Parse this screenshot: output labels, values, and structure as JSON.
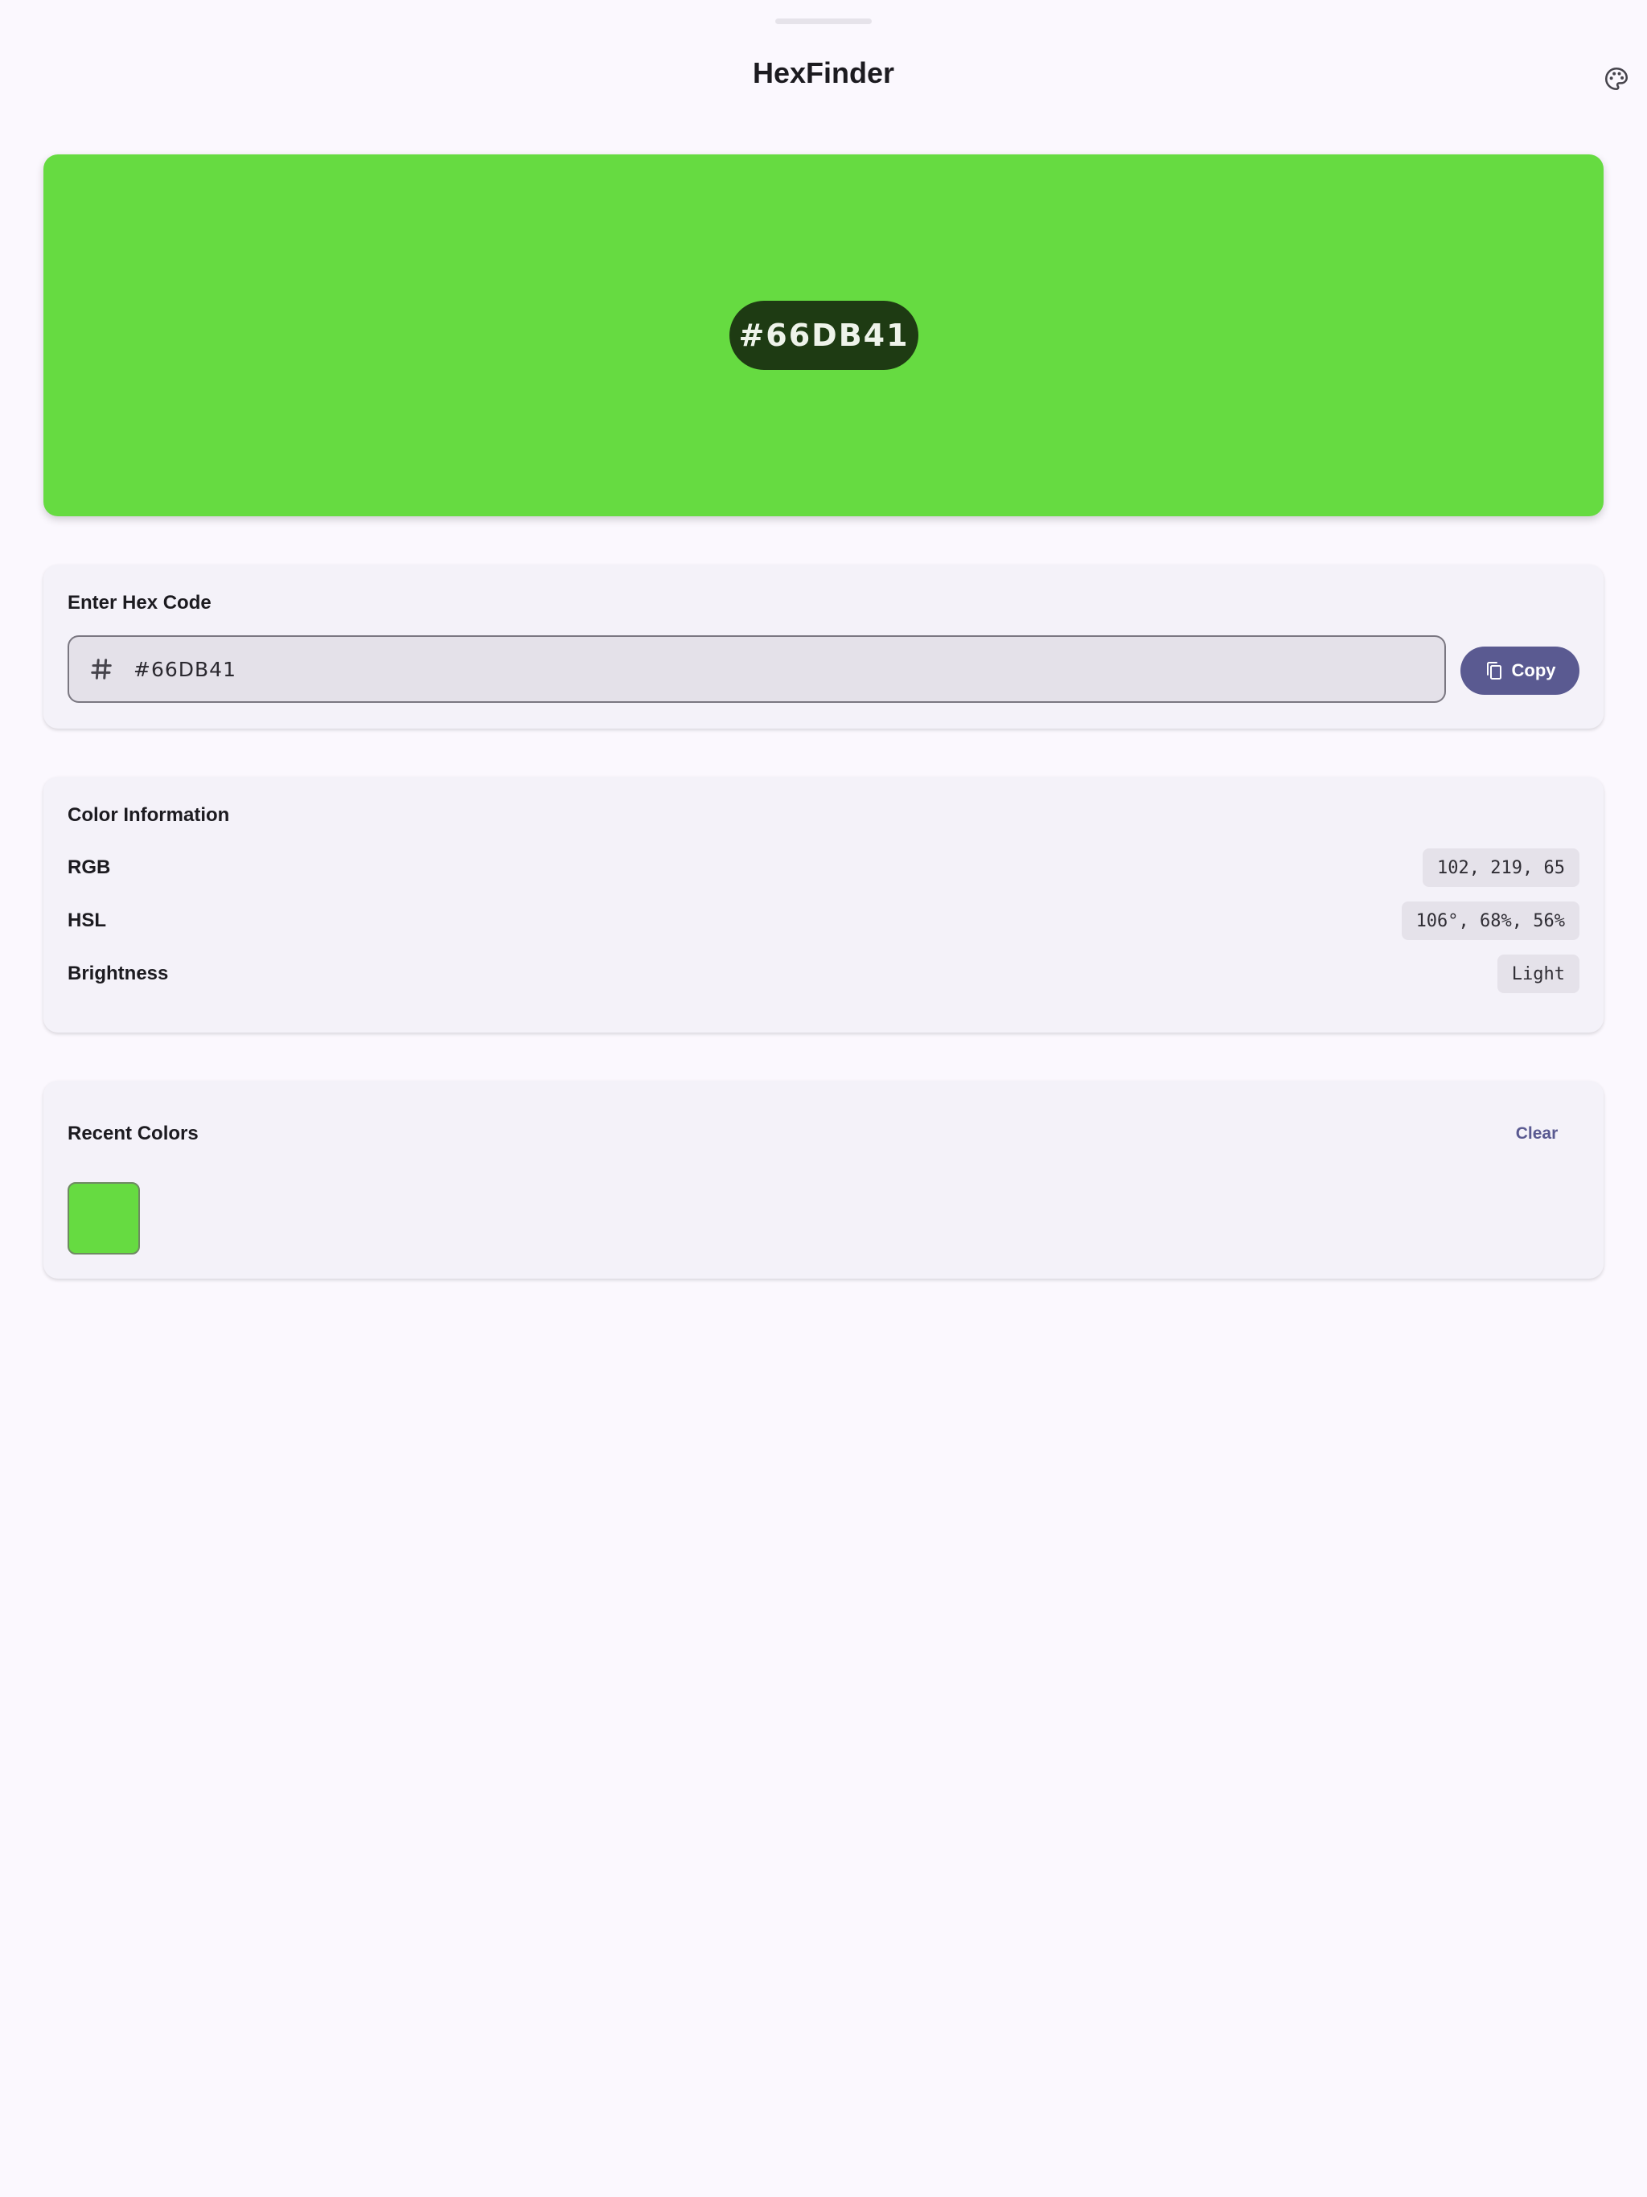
{
  "app": {
    "title": "HexFinder",
    "palette_icon": "palette-icon"
  },
  "current_color": {
    "hex": "#66DB41",
    "badge_bg": "#1e3b13"
  },
  "hex_input": {
    "title": "Enter Hex Code",
    "value": "#66DB41",
    "prefix_icon": "hash-icon",
    "copy_label": "Copy",
    "copy_icon": "copy-icon"
  },
  "color_info": {
    "title": "Color Information",
    "rows": [
      {
        "label": "RGB",
        "value": "102, 219, 65"
      },
      {
        "label": "HSL",
        "value": "106°, 68%, 56%"
      },
      {
        "label": "Brightness",
        "value": "Light"
      }
    ]
  },
  "recent": {
    "title": "Recent Colors",
    "clear_label": "Clear",
    "colors": [
      "#66DB41"
    ]
  },
  "colors": {
    "accent": "#5a5a91",
    "background": "#fbf8fe",
    "card": "#f4f2f9"
  }
}
